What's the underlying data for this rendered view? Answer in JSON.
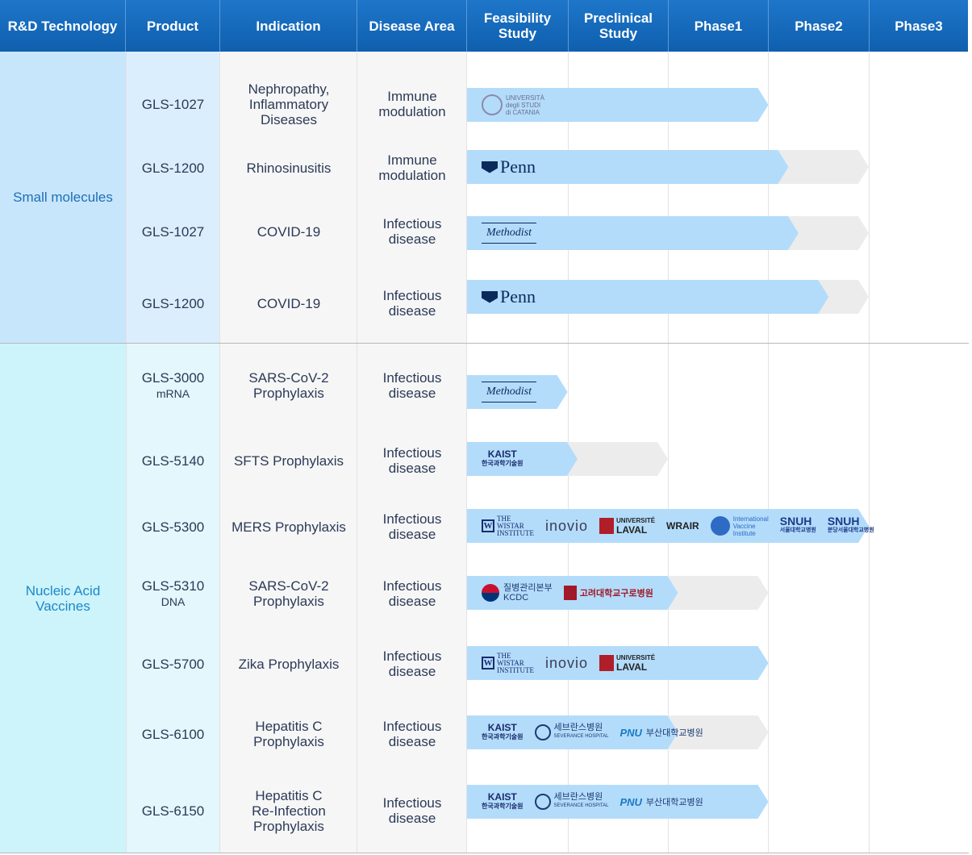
{
  "header": {
    "tech": "R&D Technology",
    "product": "Product",
    "indication": "Indication",
    "disease_area": "Disease Area",
    "feasibility": "Feasibility\nStudy",
    "preclinical": "Preclinical\nStudy",
    "phase1": "Phase1",
    "phase2": "Phase2",
    "phase3": "Phase3"
  },
  "categories": {
    "small": "Small molecules",
    "nucleic": "Nucleic Acid\nVaccines"
  },
  "colors": {
    "header_blue": "#1565c0",
    "bar_active": "#b3dcfb",
    "bar_planned": "#ececec",
    "small_bg": "#c8e6fb",
    "nucleic_bg": "#cdf3fb"
  },
  "rows": [
    {
      "product": "GLS-1027",
      "product_sub": "",
      "indication": "Nephropathy,\nInflammatory\nDiseases",
      "disease": "Immune\nmodulation",
      "active_end": 3,
      "planned_end": 3,
      "logos": [
        "catania"
      ]
    },
    {
      "product": "GLS-1200",
      "product_sub": "",
      "indication": "Rhinosinusitis",
      "disease": "Immune\nmodulation",
      "active_end": 3.2,
      "planned_end": 4,
      "logos": [
        "penn"
      ]
    },
    {
      "product": "GLS-1027",
      "product_sub": "",
      "indication": "COVID-19",
      "disease": "Infectious\ndisease",
      "active_end": 3.3,
      "planned_end": 4,
      "logos": [
        "methodist"
      ]
    },
    {
      "product": "GLS-1200",
      "product_sub": "",
      "indication": "COVID-19",
      "disease": "Infectious\ndisease",
      "active_end": 3.6,
      "planned_end": 4,
      "logos": [
        "penn"
      ]
    },
    {
      "product": "GLS-3000",
      "product_sub": "mRNA",
      "indication": "SARS-CoV-2\nProphylaxis",
      "disease": "Infectious\ndisease",
      "active_end": 1,
      "planned_end": 1,
      "logos": [
        "methodist"
      ]
    },
    {
      "product": "GLS-5140",
      "product_sub": "",
      "indication": "SFTS Prophylaxis",
      "disease": "Infectious\ndisease",
      "active_end": 1.1,
      "planned_end": 2,
      "logos": [
        "kaist"
      ]
    },
    {
      "product": "GLS-5300",
      "product_sub": "",
      "indication": "MERS Prophylaxis",
      "disease": "Infectious\ndisease",
      "active_end": 4,
      "planned_end": 4,
      "logos": [
        "wistar",
        "inovio",
        "laval",
        "wrair",
        "ivi",
        "snuh",
        "snuh_b"
      ]
    },
    {
      "product": "GLS-5310",
      "product_sub": "DNA",
      "indication": "SARS-CoV-2\nProphylaxis",
      "disease": "Infectious\ndisease",
      "active_end": 2.1,
      "planned_end": 3,
      "logos": [
        "kcdc",
        "kumc"
      ]
    },
    {
      "product": "GLS-5700",
      "product_sub": "",
      "indication": "Zika Prophylaxis",
      "disease": "Infectious\ndisease",
      "active_end": 3,
      "planned_end": 3,
      "logos": [
        "wistar",
        "inovio",
        "laval"
      ]
    },
    {
      "product": "GLS-6100",
      "product_sub": "",
      "indication": "Hepatitis C\nProphylaxis",
      "disease": "Infectious\ndisease",
      "active_end": 2.1,
      "planned_end": 3,
      "logos": [
        "kaist",
        "sev",
        "pnu"
      ]
    },
    {
      "product": "GLS-6150",
      "product_sub": "",
      "indication": "Hepatitis C\nRe-Infection\nProphylaxis",
      "disease": "Infectious\ndisease",
      "active_end": 3,
      "planned_end": 3,
      "logos": [
        "kaist",
        "sev",
        "pnu"
      ]
    }
  ],
  "logo_text": {
    "catania_1": "UNIVERSITÀ",
    "catania_2": "degli STUDI",
    "catania_3": "di CATANIA",
    "penn": "Penn",
    "methodist": "Methodist",
    "kaist": "KAIST",
    "kaist_kr": "한국과학기술원",
    "wistar_1": "THE",
    "wistar_2": "WISTAR",
    "wistar_3": "INSTITUTE",
    "inovio": "inovio",
    "laval_1": "UNIVERSITÉ",
    "laval_2": "LAVAL",
    "wrair": "WRAIR",
    "ivi_1": "International",
    "ivi_2": "Vaccine",
    "ivi_3": "Institute",
    "snuh": "SNUH",
    "snuh_kr": "서울대학교병원",
    "snuh_b_kr": "분당서울대학교병원",
    "kcdc_kr": "질병관리본부",
    "kcdc": "KCDC",
    "kumc": "고려대학교구로병원",
    "sev": "세브란스병원",
    "sev_en": "SEVERANCE HOSPITAL",
    "pnu": "PNU",
    "pnu_kr": "부산대학교병원"
  }
}
